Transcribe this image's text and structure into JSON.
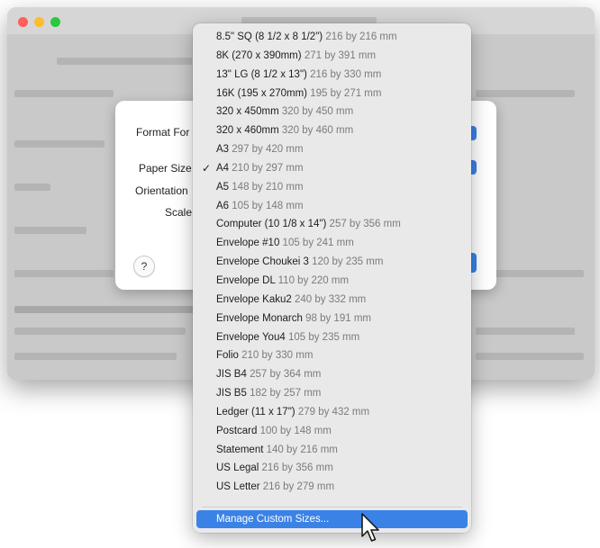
{
  "dialog": {
    "labels": {
      "format_for": "Format For",
      "paper_size": "Paper Size",
      "orientation": "Orientation",
      "scale": "Scale"
    },
    "help_label": "?"
  },
  "paper_menu": {
    "selected": "A4",
    "items": [
      {
        "name": "8.5\" SQ (8 1/2 x 8 1/2\")",
        "dims": "216 by 216 mm"
      },
      {
        "name": "8K (270 x 390mm)",
        "dims": "271 by 391 mm"
      },
      {
        "name": "13\" LG (8 1/2 x 13\")",
        "dims": "216 by 330 mm"
      },
      {
        "name": "16K (195 x 270mm)",
        "dims": "195 by 271 mm"
      },
      {
        "name": "320 x 450mm",
        "dims": "320 by 450 mm"
      },
      {
        "name": "320 x 460mm",
        "dims": "320 by 460 mm"
      },
      {
        "name": "A3",
        "dims": "297 by 420 mm"
      },
      {
        "name": "A4",
        "dims": "210 by 297 mm"
      },
      {
        "name": "A5",
        "dims": "148 by 210 mm"
      },
      {
        "name": "A6",
        "dims": "105 by 148 mm"
      },
      {
        "name": "Computer (10 1/8 x 14\")",
        "dims": "257 by 356 mm"
      },
      {
        "name": "Envelope #10",
        "dims": "105 by 241 mm"
      },
      {
        "name": "Envelope Choukei 3",
        "dims": "120 by 235 mm"
      },
      {
        "name": "Envelope DL",
        "dims": "110 by 220 mm"
      },
      {
        "name": "Envelope Kaku2",
        "dims": "240 by 332 mm"
      },
      {
        "name": "Envelope Monarch",
        "dims": "98 by 191 mm"
      },
      {
        "name": "Envelope You4",
        "dims": "105 by 235 mm"
      },
      {
        "name": "Folio",
        "dims": "210 by 330 mm"
      },
      {
        "name": "JIS B4",
        "dims": "257 by 364 mm"
      },
      {
        "name": "JIS B5",
        "dims": "182 by 257 mm"
      },
      {
        "name": "Ledger (11 x 17\")",
        "dims": "279 by 432 mm"
      },
      {
        "name": "Postcard",
        "dims": "100 by 148 mm"
      },
      {
        "name": "Statement",
        "dims": "140 by 216 mm"
      },
      {
        "name": "US Legal",
        "dims": "216 by 356 mm"
      },
      {
        "name": "US Letter",
        "dims": "216 by 279 mm"
      }
    ],
    "manage_custom": "Manage Custom Sizes..."
  },
  "colors": {
    "accent": "#3b82e6",
    "traffic_close": "#ff5f57",
    "traffic_min": "#febc2e",
    "traffic_max": "#28c840"
  }
}
